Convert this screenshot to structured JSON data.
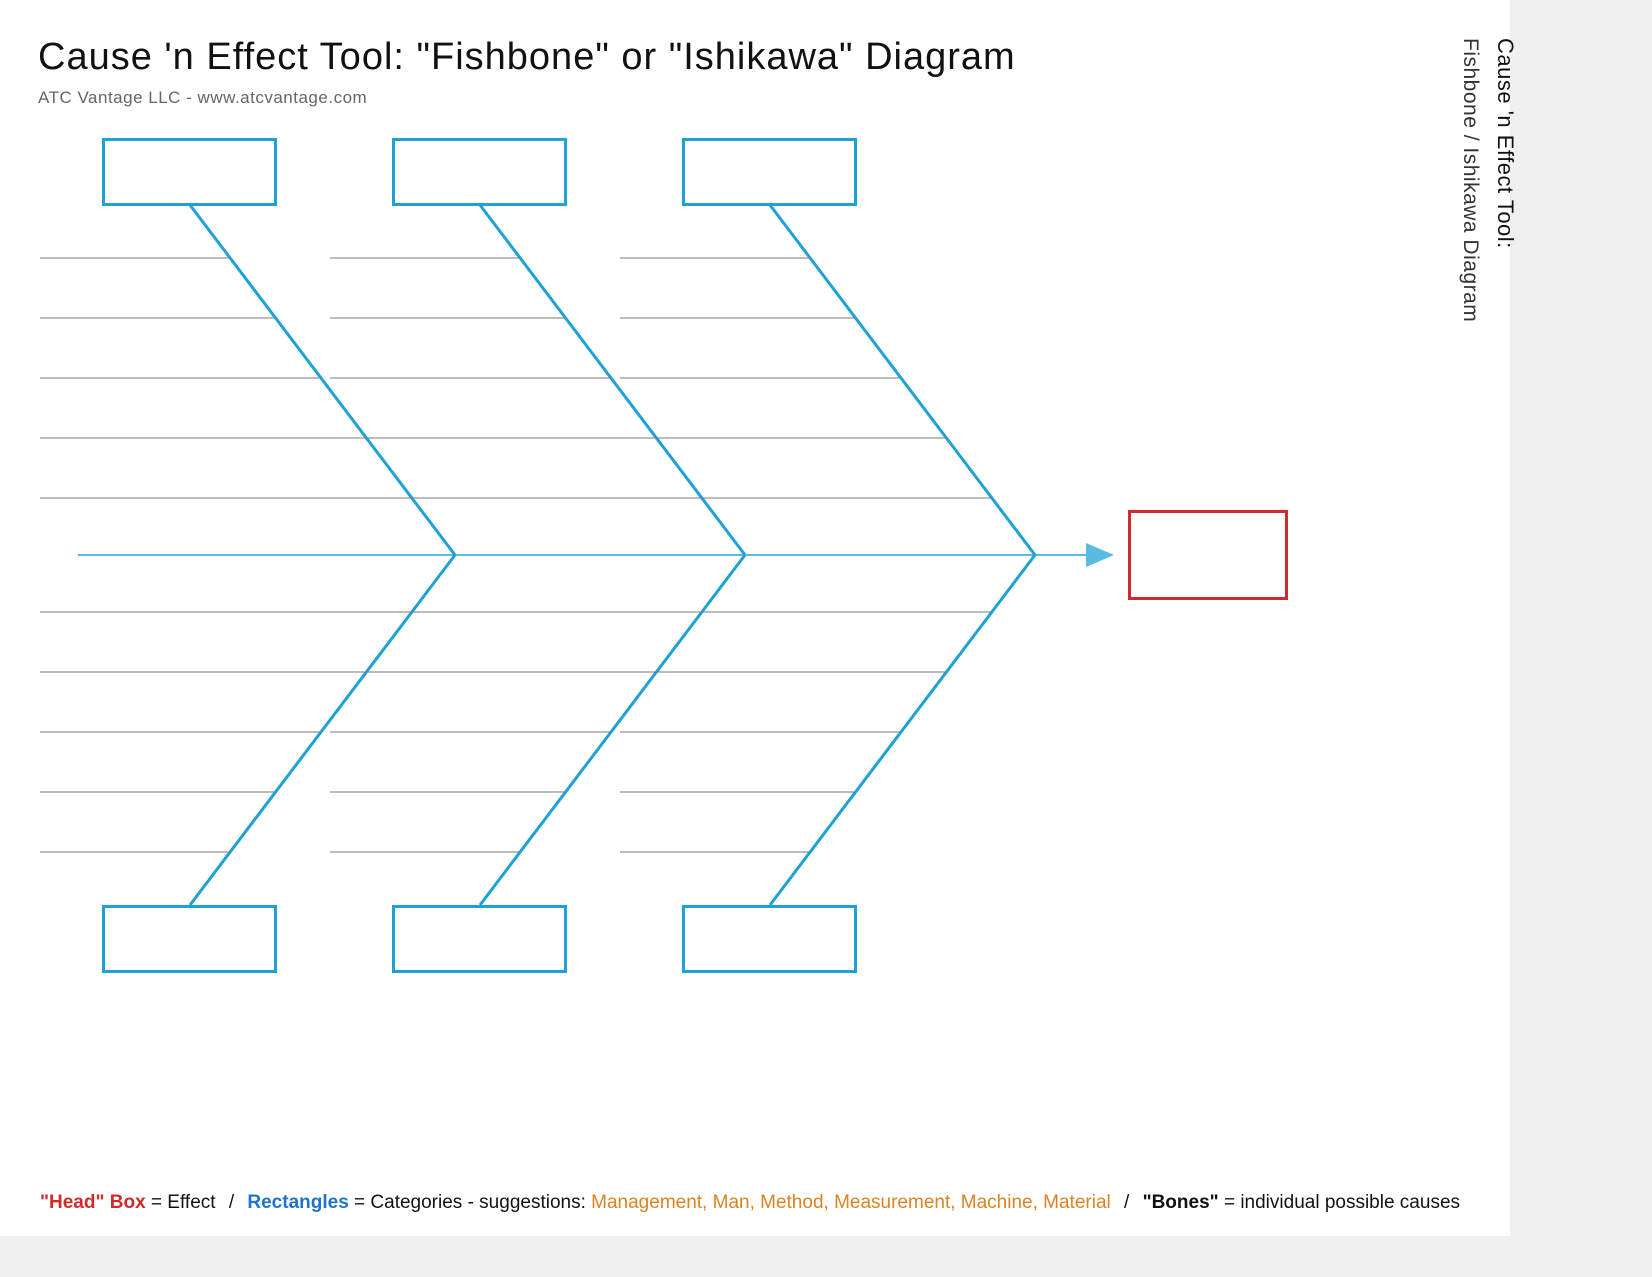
{
  "header": {
    "title": "Cause 'n Effect Tool:   \"Fishbone\" or \"Ishikawa\"  Diagram",
    "subtitle": "ATC Vantage LLC  -  www.atcvantage.com"
  },
  "side": {
    "title": "Cause 'n Effect Tool:",
    "subtitle": "Fishbone / Ishikawa Diagram"
  },
  "legend": {
    "head_label": "\"Head\" Box",
    "head_eq": " = Effect",
    "rect_label": "Rectangles",
    "rect_eq": " = Categories -  suggestions: ",
    "suggestions": "Management, Man, Method, Measurement, Machine, Material",
    "bones_label": "\"Bones\"",
    "bones_eq": "  = individual possible causes",
    "sep": "  /  "
  },
  "colors": {
    "bone": "#1ea1d6",
    "spine": "#5abbe0",
    "subbone": "#7a7a7a",
    "head": "#d22a2a"
  },
  "tiny_mark": ""
}
